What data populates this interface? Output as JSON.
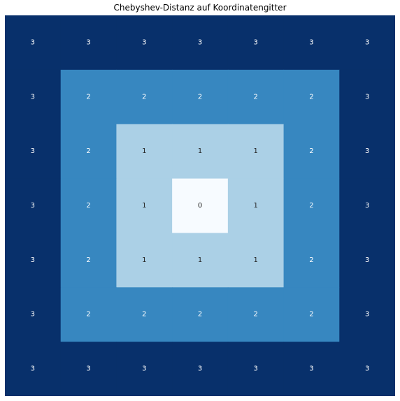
{
  "chart_data": {
    "type": "heatmap",
    "title": "Chebyshev-Distanz auf Koordinatengitter",
    "rows": 7,
    "cols": 7,
    "values": [
      [
        3,
        3,
        3,
        3,
        3,
        3,
        3
      ],
      [
        3,
        2,
        2,
        2,
        2,
        2,
        3
      ],
      [
        3,
        2,
        1,
        1,
        1,
        2,
        3
      ],
      [
        3,
        2,
        1,
        0,
        1,
        2,
        3
      ],
      [
        3,
        2,
        1,
        1,
        1,
        2,
        3
      ],
      [
        3,
        2,
        2,
        2,
        2,
        2,
        3
      ],
      [
        3,
        3,
        3,
        3,
        3,
        3,
        3
      ]
    ],
    "colormap": "Blues",
    "value_range": [
      0,
      3
    ],
    "value_colors": {
      "0": "#f7fbff",
      "1": "#abd0e6",
      "2": "#3787c0",
      "3": "#08306b"
    },
    "annotation_colors": {
      "light": "#ffffff",
      "dark": "#262626"
    },
    "colorbar": false,
    "axes_ticks": false
  }
}
